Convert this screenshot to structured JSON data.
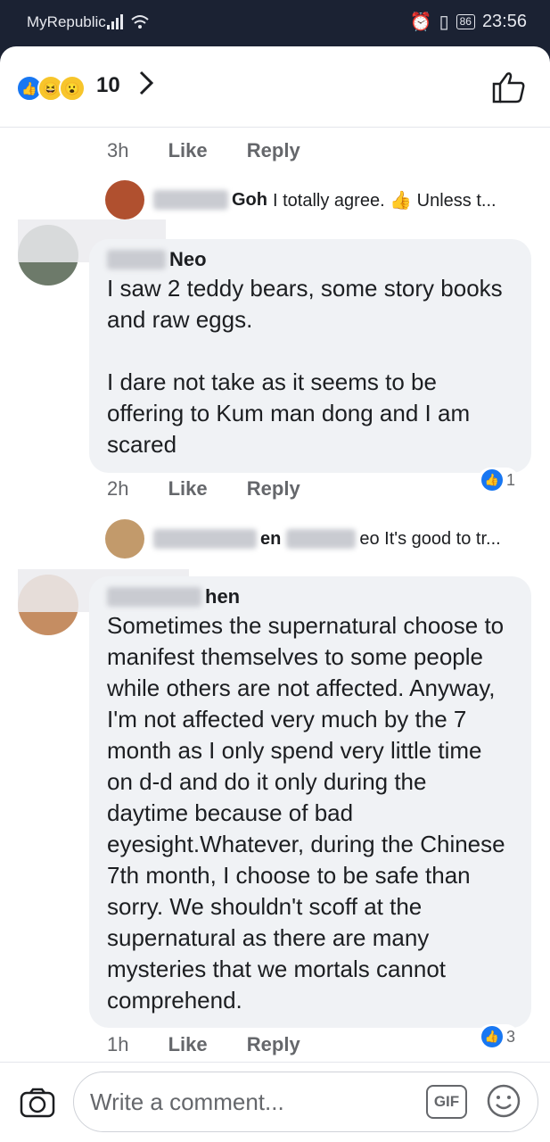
{
  "status_bar": {
    "carrier": "MyRepublic",
    "battery": "86",
    "time": "23:56"
  },
  "reactions": {
    "count": "10",
    "icons": [
      "like-icon",
      "haha-icon",
      "wow-icon"
    ]
  },
  "top_meta": {
    "time": "3h",
    "like": "Like",
    "reply": "Reply"
  },
  "reply_preview_1": {
    "name": "Goh",
    "text": "I totally agree. 👍 Unless t..."
  },
  "comment_1": {
    "author": "Neo",
    "text": "I saw 2 teddy bears, some story books and raw eggs.\n\nI dare not take as it seems to be offering to Kum man dong and I am scared",
    "time": "2h",
    "like": "Like",
    "reply": "Reply",
    "reaction_count": "1"
  },
  "reply_preview_2": {
    "name": "en",
    "text": "eo It's good to tr..."
  },
  "comment_2": {
    "author": "hen",
    "text": "Sometimes the supernatural choose to manifest themselves to some people while others are not affected. Anyway, I'm not affected very much by the 7 month as I only spend very little time on d-d and do it only during the daytime because of bad eyesight.Whatever, during the Chinese 7th month, I choose to be safe than sorry. We shouldn't scoff at the supernatural as there are many mysteries that we mortals cannot comprehend.",
    "time": "1h",
    "like": "Like",
    "reply": "Reply",
    "reaction_count": "3"
  },
  "composer": {
    "placeholder": "Write a comment...",
    "gif": "GIF"
  },
  "colors": {
    "accent": "#1877f2",
    "bubble": "#f0f2f5",
    "status_bg": "#1b2233"
  }
}
